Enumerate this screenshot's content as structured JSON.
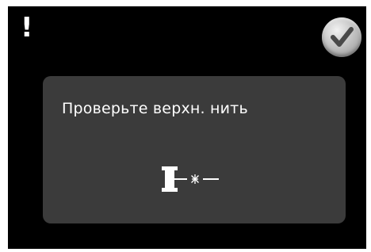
{
  "alert": {
    "symbol": "!",
    "message": "Проверьте верхн. нить",
    "graphic_icon": "spool-thread-break-icon"
  },
  "confirm_button": {
    "icon": "checkmark-icon"
  },
  "colors": {
    "screen_background": "#000000",
    "panel_background": "#3b3b3b",
    "text": "#ffffff",
    "button_gray": "#c4c4c4"
  }
}
